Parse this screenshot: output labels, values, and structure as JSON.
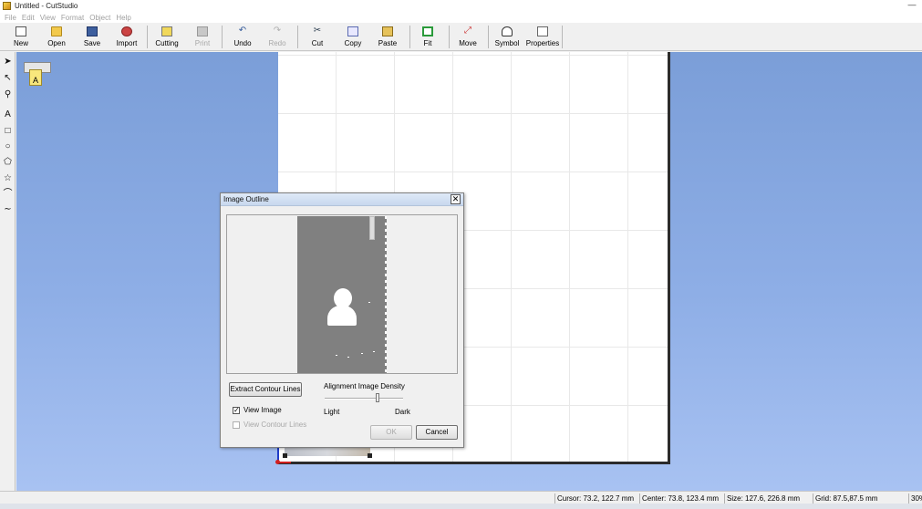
{
  "window": {
    "title": "Untitled - CutStudio",
    "min_glyph": "—"
  },
  "menu": [
    "File",
    "Edit",
    "View",
    "Format",
    "Object",
    "Help"
  ],
  "toolbar": {
    "new": "New",
    "open": "Open",
    "save": "Save",
    "import": "Import",
    "cutting": "Cutting",
    "print": "Print",
    "undo": "Undo",
    "redo": "Redo",
    "cut": "Cut",
    "copy": "Copy",
    "paste": "Paste",
    "fit": "Fit",
    "move": "Move",
    "symbol": "Symbol",
    "properties": "Properties"
  },
  "tools": {
    "select": "➤",
    "node": "↖",
    "zoom": "⚲",
    "text": "A",
    "rect": "□",
    "ellipse": "○",
    "polygon": "⬠",
    "star": "☆",
    "polyline": "⌒",
    "curve": "∼"
  },
  "icons": {
    "undo": "↶",
    "redo": "↷",
    "cut": "✂",
    "move": "⤢",
    "close": "✕",
    "check": "✓",
    "plotter_paper": "A"
  },
  "dialog": {
    "title": "Image Outline",
    "extract_button": "Extract Contour Lines",
    "density_label": "Alignment Image Density",
    "density_level": 0.68,
    "light": "Light",
    "dark": "Dark",
    "view_image": "View Image",
    "view_image_checked": true,
    "view_contour": "View Contour Lines",
    "view_contour_checked": false,
    "ok": "OK",
    "cancel": "Cancel"
  },
  "status": {
    "cursor": "Cursor: 73.2, 122.7 mm",
    "center": "Center: 73.8, 123.4 mm",
    "size": "Size: 127.6, 226.8 mm",
    "grid": "Grid: 87.5,87.5 mm",
    "zoom": "30%"
  },
  "colors": {
    "workspace_top": "#7b9ed8",
    "workspace_bottom": "#a8c2f2",
    "image_gray": "#808080"
  }
}
